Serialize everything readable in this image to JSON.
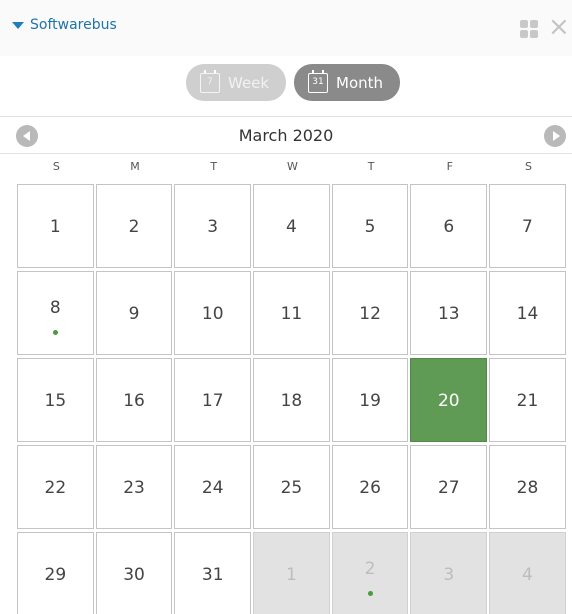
{
  "app": {
    "title": "Softwarebus"
  },
  "icons": {
    "collapse": "triangle-down-icon",
    "grid": "grid-icon",
    "close": "close-icon",
    "prev": "arrow-left-icon",
    "next": "arrow-right-icon"
  },
  "colors": {
    "accent": "#1e73a8",
    "today": "#609b56",
    "event_dot": "#4a9a40"
  },
  "view": {
    "week_label": "Week",
    "week_icon_text": "7",
    "month_label": "Month",
    "month_icon_text": "31",
    "selected": "Month"
  },
  "calendar": {
    "month_title": "March 2020",
    "weekdays": [
      "S",
      "M",
      "T",
      "W",
      "T",
      "F",
      "S"
    ],
    "weeks": [
      [
        {
          "d": "1"
        },
        {
          "d": "2"
        },
        {
          "d": "3"
        },
        {
          "d": "4"
        },
        {
          "d": "5"
        },
        {
          "d": "6"
        },
        {
          "d": "7"
        }
      ],
      [
        {
          "d": "8",
          "event": true
        },
        {
          "d": "9"
        },
        {
          "d": "10"
        },
        {
          "d": "11"
        },
        {
          "d": "12"
        },
        {
          "d": "13"
        },
        {
          "d": "14"
        }
      ],
      [
        {
          "d": "15"
        },
        {
          "d": "16"
        },
        {
          "d": "17"
        },
        {
          "d": "18"
        },
        {
          "d": "19"
        },
        {
          "d": "20",
          "today": true
        },
        {
          "d": "21"
        }
      ],
      [
        {
          "d": "22"
        },
        {
          "d": "23"
        },
        {
          "d": "24"
        },
        {
          "d": "25"
        },
        {
          "d": "26"
        },
        {
          "d": "27"
        },
        {
          "d": "28"
        }
      ],
      [
        {
          "d": "29"
        },
        {
          "d": "30"
        },
        {
          "d": "31"
        },
        {
          "d": "1",
          "other": true
        },
        {
          "d": "2",
          "other": true,
          "event": true
        },
        {
          "d": "3",
          "other": true
        },
        {
          "d": "4",
          "other": true
        }
      ]
    ]
  }
}
